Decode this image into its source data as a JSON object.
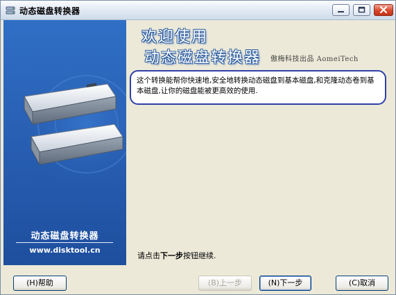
{
  "window": {
    "title": "动态磁盘转换器"
  },
  "sidebar": {
    "title": "动态磁盘转换器",
    "url": "www.disktool.cn"
  },
  "content": {
    "welcome_line1": "欢迎使用",
    "welcome_line2": "动态磁盘转换器",
    "publisher": "傲梅科技出品 AomeiTech",
    "description": "这个转换能帮你快速地,安全地转换动态磁盘到基本磁盘,和克隆动态卷到基本磁盘,让你的磁盘能被更高效的使用.",
    "hint_prefix": "请点击",
    "hint_bold": "下一步",
    "hint_suffix": "按钮继续."
  },
  "buttons": {
    "help": "(H)帮助",
    "prev": "(B)上一步",
    "next": "(N)下一步",
    "cancel": "(C)取消"
  }
}
